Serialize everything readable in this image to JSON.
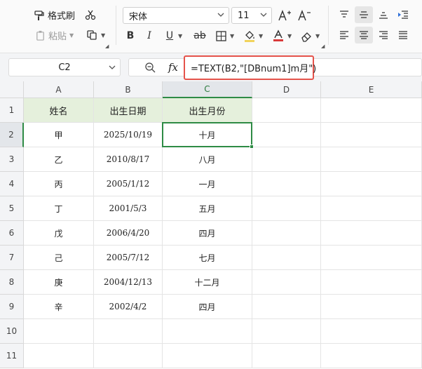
{
  "ribbon": {
    "format_painter_label": "格式刷",
    "paste_label": "粘贴",
    "font_name": "宋体",
    "font_size": "11"
  },
  "name_box": {
    "value": "C2"
  },
  "formula": {
    "fx_label": "fx",
    "value": "=TEXT(B2,\"[DBnum1]m月\")"
  },
  "columns": [
    "A",
    "B",
    "C",
    "D",
    "E"
  ],
  "rows": [
    "1",
    "2",
    "3",
    "4",
    "5",
    "6",
    "7",
    "8",
    "9",
    "10",
    "11"
  ],
  "table": {
    "headers": [
      "姓名",
      "出生日期",
      "出生月份"
    ],
    "rows": [
      [
        "甲",
        "2025/10/19",
        "十月"
      ],
      [
        "乙",
        "2010/8/17",
        "八月"
      ],
      [
        "丙",
        "2005/1/12",
        "一月"
      ],
      [
        "丁",
        "2001/5/3",
        "五月"
      ],
      [
        "戊",
        "2006/4/20",
        "四月"
      ],
      [
        "己",
        "2005/7/12",
        "七月"
      ],
      [
        "庚",
        "2004/12/13",
        "十二月"
      ],
      [
        "辛",
        "2002/4/2",
        "四月"
      ]
    ]
  },
  "colors": {
    "accent": "#2e8b45",
    "header_fill": "#e5f0dc",
    "highlight": "#e5534b"
  }
}
